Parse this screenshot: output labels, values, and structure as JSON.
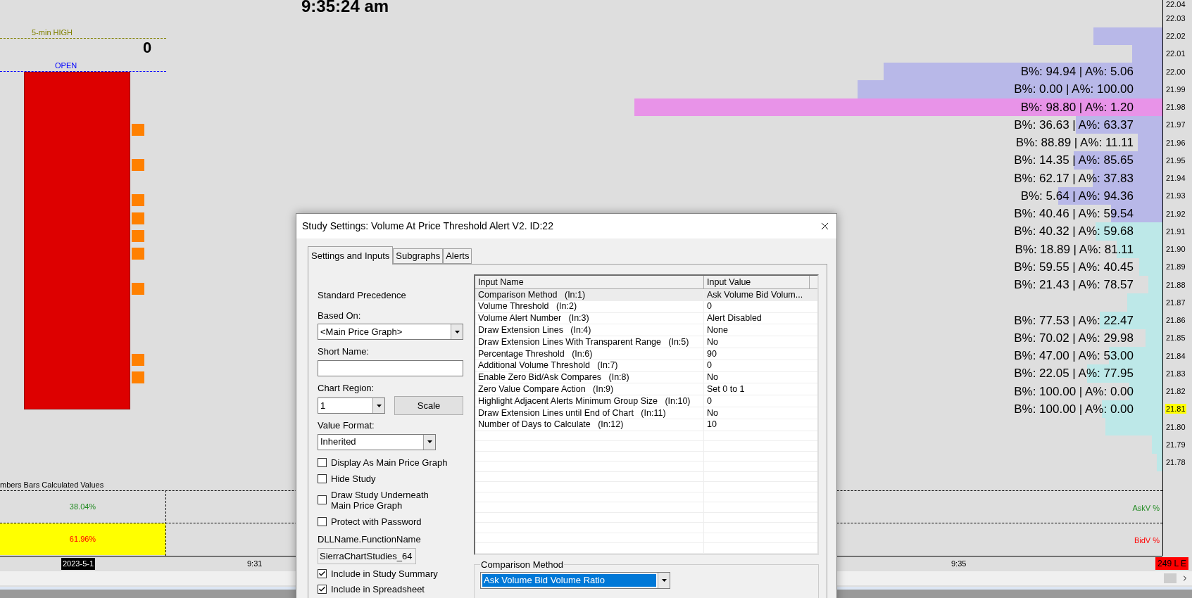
{
  "chart": {
    "clock": "9:35:24 am",
    "counter": "0",
    "lines": [
      {
        "label": "5-min HIGH",
        "color": "#808000"
      },
      {
        "label": "OPEN",
        "color": "#0000ff"
      }
    ],
    "profile": [
      {
        "price": "22.04",
        "current": false
      },
      {
        "price": "22.03",
        "current": false
      },
      {
        "price": "22.02",
        "current": false,
        "color": "#b8b8e8"
      },
      {
        "price": "22.01",
        "current": false,
        "color": "#b8b8e8"
      },
      {
        "price": "22.00",
        "current": false,
        "color": "#b8b8e8",
        "label": "B%: 94.94 | A%: 5.06"
      },
      {
        "price": "21.99",
        "current": false,
        "color": "#b8b8e8",
        "label": "B%: 0.00 | A%: 100.00"
      },
      {
        "price": "21.98",
        "current": false,
        "color": "#e893e8",
        "label": "B%: 98.80 | A%: 1.20"
      },
      {
        "price": "21.97",
        "current": false,
        "color": "#b8b8e8",
        "label": "B%: 36.63 | A%: 63.37"
      },
      {
        "price": "21.96",
        "current": false,
        "color": "#b8b8e8",
        "label": "B%: 88.89 | A%: 11.11"
      },
      {
        "price": "21.95",
        "current": false,
        "color": "#b8b8e8",
        "label": "B%: 14.35 | A%: 85.65"
      },
      {
        "price": "21.94",
        "current": false,
        "color": "#b8b8e8",
        "label": "B%: 62.17 | A%: 37.83"
      },
      {
        "price": "21.93",
        "current": false,
        "color": "#b8b8e8",
        "label": "B%: 5.64 | A%: 94.36"
      },
      {
        "price": "21.92",
        "current": false,
        "color": "#b8b8e8",
        "label": "B%: 40.46 | A%: 59.54"
      },
      {
        "price": "21.91",
        "current": false,
        "color": "#bde8e8",
        "label": "B%: 40.32 | A%: 59.68"
      },
      {
        "price": "21.90",
        "current": false,
        "color": "#bde8e8",
        "label": "B%: 18.89 | A%: 81.11"
      },
      {
        "price": "21.89",
        "current": false,
        "color": "#bde8e8",
        "label": "B%: 59.55 | A%: 40.45"
      },
      {
        "price": "21.88",
        "current": false,
        "color": "#bde8e8",
        "label": "B%: 21.43 | A%: 78.57"
      },
      {
        "price": "21.87",
        "current": false,
        "color": "#bde8e8"
      },
      {
        "price": "21.86",
        "current": false,
        "color": "#bde8e8",
        "label": "B%: 77.53 | A%: 22.47"
      },
      {
        "price": "21.85",
        "current": false,
        "color": "#bde8e8",
        "label": "B%: 70.02 | A%: 29.98"
      },
      {
        "price": "21.84",
        "current": false,
        "color": "#bde8e8",
        "label": "B%: 47.00 | A%: 53.00"
      },
      {
        "price": "21.83",
        "current": false,
        "color": "#bde8e8",
        "label": "B%: 22.05 | A%: 77.95"
      },
      {
        "price": "21.82",
        "current": false,
        "color": "#bde8e8",
        "label": "B%: 100.00 | A%: 0.00"
      },
      {
        "price": "21.81",
        "current": true,
        "color": "#bde8e8",
        "label": "B%: 100.00 | A%: 0.00"
      },
      {
        "price": "21.80",
        "current": false,
        "color": "#bde8e8"
      },
      {
        "price": "21.79",
        "current": false,
        "color": "#bde8e8"
      },
      {
        "price": "21.78",
        "current": false,
        "color": "#bde8e8"
      }
    ],
    "study_title": "mbers Bars Calculated Values",
    "subgraphs": [
      {
        "name": "AskV %",
        "value": "38.04%",
        "color": "#228b22",
        "highlighted": false
      },
      {
        "name": "BidV %",
        "value": "61.96%",
        "color": "#ff0000",
        "highlighted": true
      }
    ],
    "time_axis": [
      {
        "label": "2023-5-1",
        "selected": true
      },
      {
        "label": "9:31",
        "selected": false
      },
      {
        "label": "9:35",
        "selected": false
      }
    ],
    "badge": "249 L E"
  },
  "dialog": {
    "title": "Study Settings: Volume At Price Threshold Alert V2. ID:22",
    "tabs": [
      {
        "label": "Settings and Inputs",
        "selected": true
      },
      {
        "label": "Subgraphs",
        "selected": false
      },
      {
        "label": "Alerts",
        "selected": false
      }
    ],
    "standard_precedence": "Standard Precedence",
    "based_on": {
      "label": "Based On:",
      "value": "<Main Price Graph>"
    },
    "short_name": {
      "label": "Short Name:"
    },
    "chart_region": {
      "label": "Chart Region:",
      "value": "1"
    },
    "scale_button": "Scale",
    "value_format": {
      "label": "Value Format:",
      "value": "Inherited"
    },
    "options": [
      {
        "label": "Display As Main Price Graph",
        "checked": false
      },
      {
        "label": "Hide Study",
        "checked": false
      },
      {
        "label": "Draw Study Underneath\nMain Price Graph",
        "checked": false
      },
      {
        "label": "Protect with Password",
        "checked": false
      }
    ],
    "dll": {
      "label": "DLLName.FunctionName",
      "value": "SierraChartStudies_64"
    },
    "options2": [
      {
        "label": "Include in Study Summary",
        "checked": true
      },
      {
        "label": "Include in Spreadsheet",
        "checked": true
      }
    ],
    "table": {
      "columns": [
        "Input Name",
        "Input Value"
      ],
      "rows": [
        {
          "name": "Comparison Method   (In:1)",
          "value": "Ask Volume Bid Volum...",
          "selected": true
        },
        {
          "name": "Volume Threshold   (In:2)",
          "value": "0",
          "selected": false
        },
        {
          "name": "Volume Alert Number   (In:3)",
          "value": "Alert Disabled",
          "selected": false
        },
        {
          "name": "Draw Extension Lines   (In:4)",
          "value": "None",
          "selected": false
        },
        {
          "name": "Draw Extension Lines With Transparent Range   (In:5)",
          "value": "No",
          "selected": false
        },
        {
          "name": "Percentage Threshold   (In:6)",
          "value": "90",
          "selected": false
        },
        {
          "name": "Additional Volume Threshold   (In:7)",
          "value": "0",
          "selected": false
        },
        {
          "name": "Enable Zero Bid/Ask Compares   (In:8)",
          "value": "No",
          "selected": false
        },
        {
          "name": "Zero Value Compare Action   (In:9)",
          "value": "Set 0 to 1",
          "selected": false
        },
        {
          "name": "Highlight Adjacent Alerts Minimum Group Size   (In:10)",
          "value": "0",
          "selected": false
        },
        {
          "name": "Draw Extension Lines until End of Chart   (In:11)",
          "value": "No",
          "selected": false
        },
        {
          "name": "Number of Days to Calculate   (In:12)",
          "value": "10",
          "selected": false
        }
      ]
    },
    "group": {
      "title": "Comparison Method",
      "value": "Ask Volume Bid Volume Ratio"
    }
  }
}
